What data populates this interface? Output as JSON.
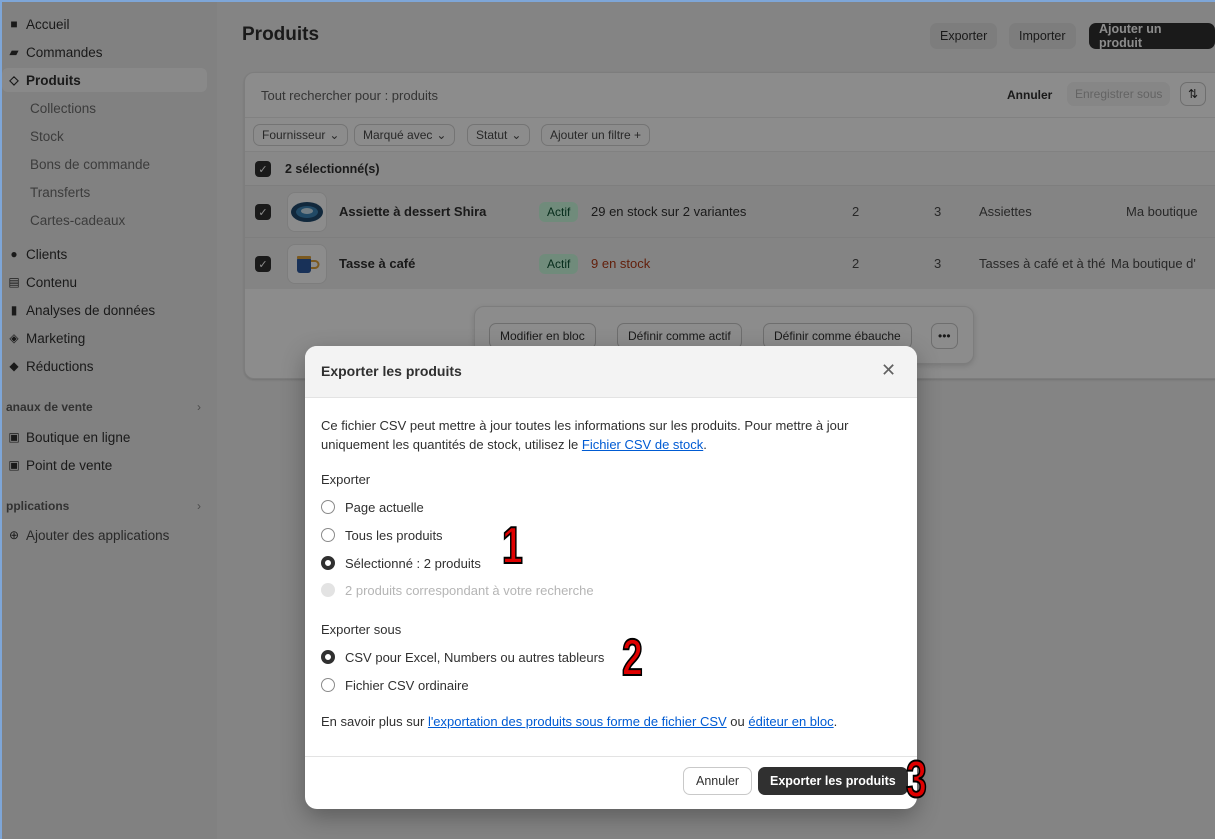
{
  "sidebar": {
    "items": [
      {
        "label": "Accueil",
        "icon": "home-icon"
      },
      {
        "label": "Commandes",
        "icon": "inbox-icon"
      },
      {
        "label": "Produits",
        "icon": "tag-icon"
      },
      {
        "label": "Collections"
      },
      {
        "label": "Stock"
      },
      {
        "label": "Bons de commande"
      },
      {
        "label": "Transferts"
      },
      {
        "label": "Cartes-cadeaux"
      },
      {
        "label": "Clients",
        "icon": "person-icon"
      },
      {
        "label": "Contenu",
        "icon": "content-icon"
      },
      {
        "label": "Analyses de données",
        "icon": "chart-icon"
      },
      {
        "label": "Marketing",
        "icon": "marketing-icon"
      },
      {
        "label": "Réductions",
        "icon": "discount-icon"
      }
    ],
    "sales_channels_label": "anaux de vente",
    "channels": [
      {
        "label": "Boutique en ligne"
      },
      {
        "label": "Point de vente"
      }
    ],
    "apps_label": "pplications",
    "add_apps": "Ajouter des applications"
  },
  "header": {
    "title": "Produits",
    "export": "Exporter",
    "import": "Importer",
    "add_product": "Ajouter un produit"
  },
  "list": {
    "search": "Tout rechercher pour : produits",
    "cancel": "Annuler",
    "save_as": "Enregistrer sous",
    "filters": [
      "Fournisseur",
      "Marqué avec",
      "Statut",
      "Ajouter un filtre +"
    ],
    "selected": "2 sélectionné(s)",
    "products": [
      {
        "name": "Assiette à dessert Shira",
        "status": "Actif",
        "stock": "29 en stock sur 2 variantes",
        "c1": "2",
        "c2": "3",
        "type": "Assiettes",
        "vendor": "Ma boutique"
      },
      {
        "name": "Tasse à café",
        "status": "Actif",
        "stock": "9 en stock",
        "c1": "2",
        "c2": "3",
        "type": "Tasses à café et à thé",
        "vendor": "Ma boutique d'"
      }
    ],
    "bulk": {
      "edit": "Modifier en bloc",
      "activate": "Définir comme actif",
      "draft": "Définir comme ébauche",
      "more": "•••"
    }
  },
  "modal": {
    "title": "Exporter les produits",
    "desc_before": "Ce fichier CSV peut mettre à jour toutes les informations sur les produits. Pour mettre à jour uniquement les quantités de stock, utilisez le ",
    "desc_link": "Fichier CSV de stock",
    "desc_after": ".",
    "export_label": "Exporter",
    "export_options": [
      {
        "label": "Page actuelle",
        "state": "off"
      },
      {
        "label": "Tous les produits",
        "state": "off"
      },
      {
        "label": "Sélectionné : 2 produits",
        "state": "on"
      },
      {
        "label": "2 produits correspondant à votre recherche",
        "state": "disabled"
      }
    ],
    "format_label": "Exporter sous",
    "format_options": [
      {
        "label": "CSV pour Excel, Numbers ou autres tableurs",
        "state": "on"
      },
      {
        "label": "Fichier CSV ordinaire",
        "state": "off"
      }
    ],
    "more_before": "En savoir plus sur ",
    "more_link1": "l'exportation des produits sous forme de fichier CSV",
    "more_mid": " ou ",
    "more_link2": "éditeur en bloc",
    "more_after": ".",
    "cancel": "Annuler",
    "export_button": "Exporter les produits"
  },
  "annotations": [
    "1",
    "2",
    "3"
  ],
  "colors": {
    "accent": "#303030",
    "link": "#005bd3",
    "active_badge": "#cdfee1",
    "annotation": "#e00000"
  }
}
